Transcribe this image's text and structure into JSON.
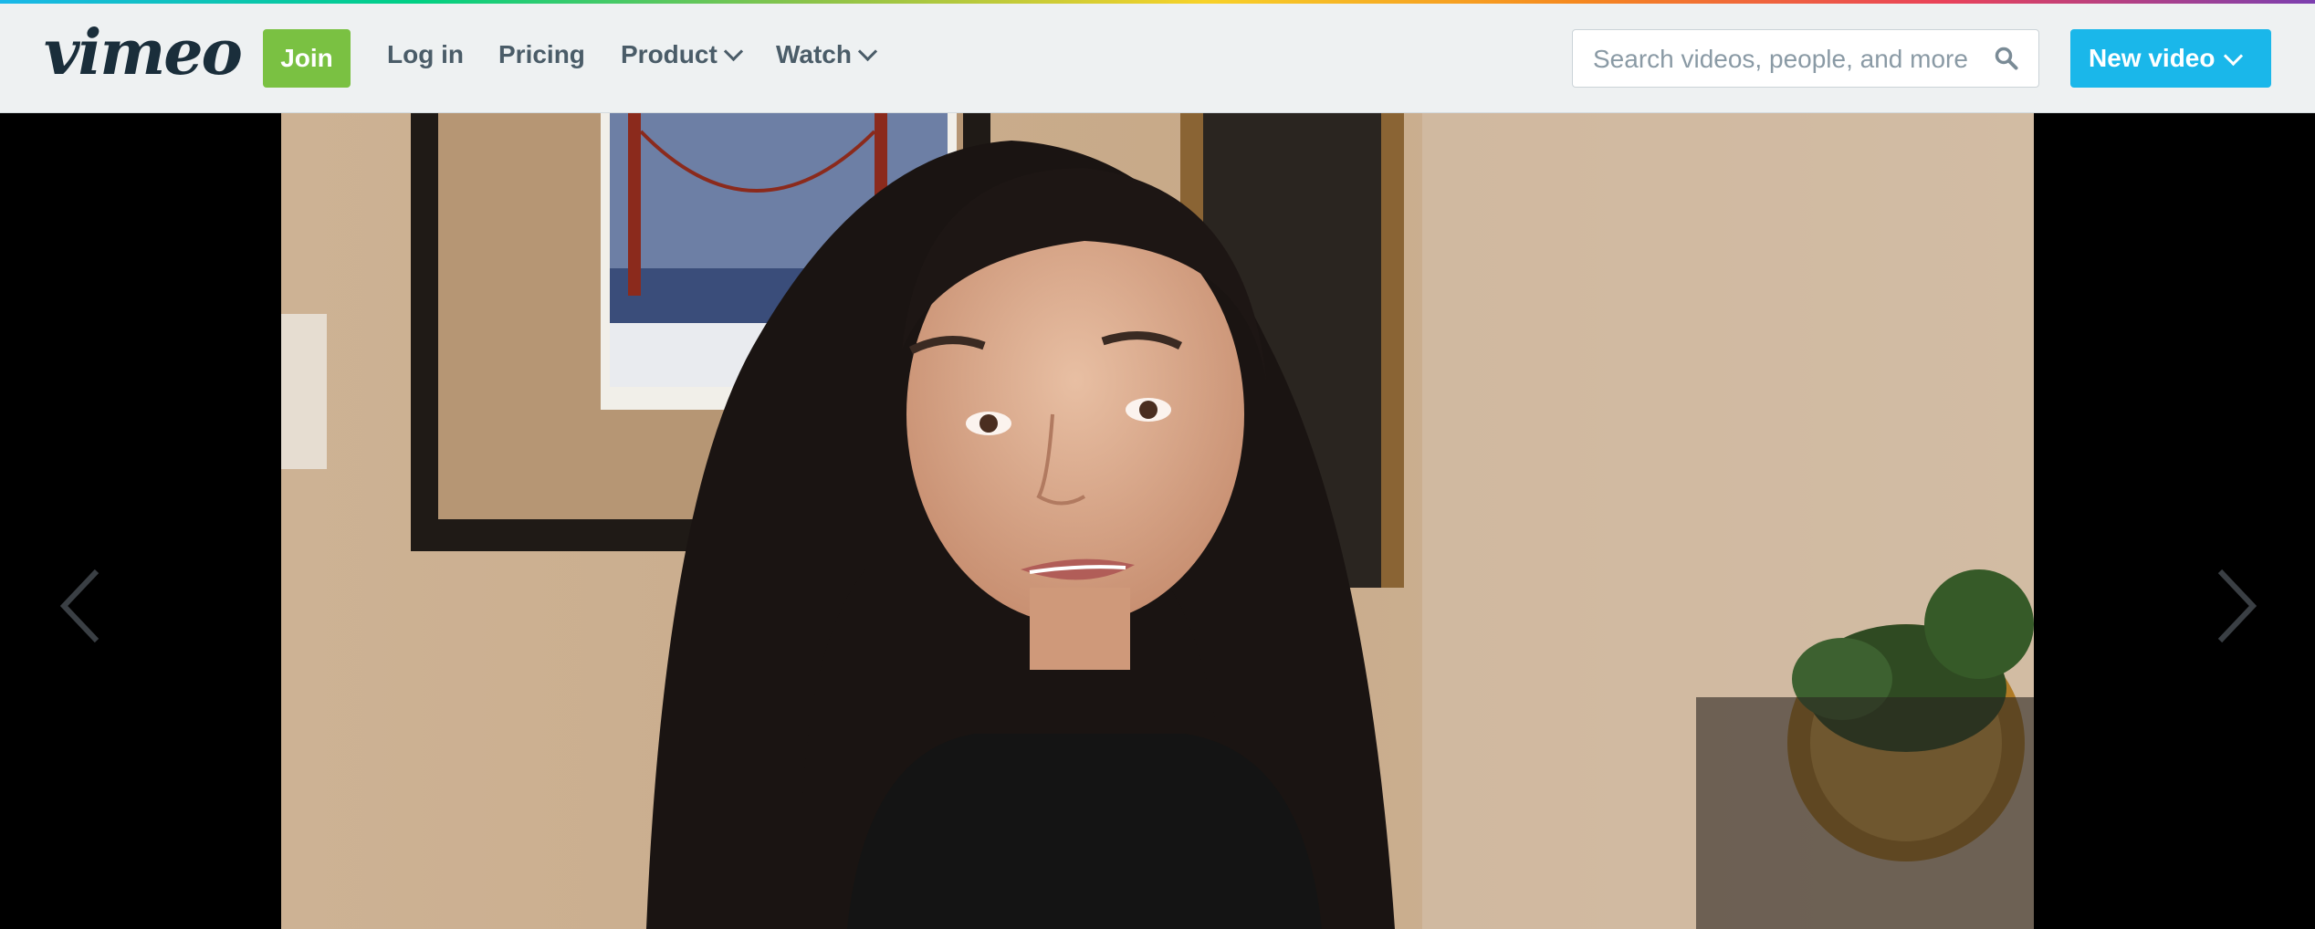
{
  "brand": {
    "logo_text": "vimeo"
  },
  "topnav": {
    "join_label": "Join",
    "login_label": "Log in",
    "pricing_label": "Pricing",
    "product_label": "Product",
    "watch_label": "Watch"
  },
  "search": {
    "placeholder": "Search videos, people, and more",
    "value": ""
  },
  "new_video": {
    "label": "New video"
  },
  "player": {
    "side_actions": [
      "heart-icon",
      "clock-icon",
      "layers-icon",
      "paper-plane-icon"
    ]
  },
  "colors": {
    "join_green": "#7ac142",
    "new_video_blue": "#1ab7ea",
    "topbar_bg": "#eef1f2",
    "player_bg": "#000000"
  }
}
